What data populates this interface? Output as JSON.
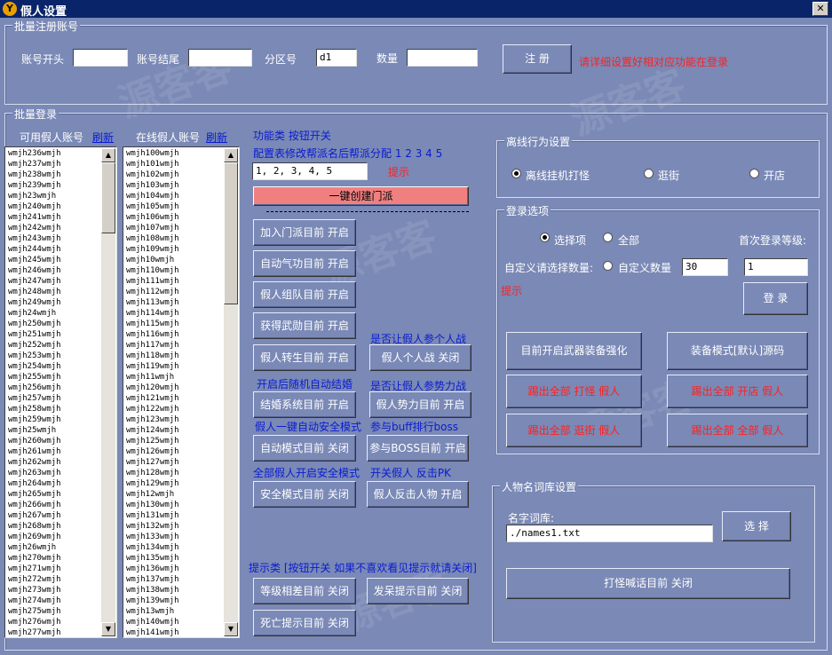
{
  "window": {
    "title": "假人设置",
    "app_icon": "Y"
  },
  "watermark": "源客客",
  "batch_register": {
    "title": "批量注册账号",
    "account_start_label": "账号开头",
    "account_start_value": "",
    "account_end_label": "账号结尾",
    "account_end_value": "",
    "zone_label": "分区号",
    "zone_value": "d1",
    "count_label": "数量",
    "count_value": "",
    "register_button": "注  册",
    "hint": "请详细设置好相对应功能在登录"
  },
  "batch_login": {
    "title": "批量登录",
    "available_label": "可用假人账号",
    "online_label": "在线假人账号",
    "refresh_label": "刷新",
    "available_list": [
      "wmjh236wmjh",
      "wmjh237wmjh",
      "wmjh238wmjh",
      "wmjh239wmjh",
      "wmjh23wmjh",
      "wmjh240wmjh",
      "wmjh241wmjh",
      "wmjh242wmjh",
      "wmjh243wmjh",
      "wmjh244wmjh",
      "wmjh245wmjh",
      "wmjh246wmjh",
      "wmjh247wmjh",
      "wmjh248wmjh",
      "wmjh249wmjh",
      "wmjh24wmjh",
      "wmjh250wmjh",
      "wmjh251wmjh",
      "wmjh252wmjh",
      "wmjh253wmjh",
      "wmjh254wmjh",
      "wmjh255wmjh",
      "wmjh256wmjh",
      "wmjh257wmjh",
      "wmjh258wmjh",
      "wmjh259wmjh",
      "wmjh25wmjh",
      "wmjh260wmjh",
      "wmjh261wmjh",
      "wmjh262wmjh",
      "wmjh263wmjh",
      "wmjh264wmjh",
      "wmjh265wmjh",
      "wmjh266wmjh",
      "wmjh267wmjh",
      "wmjh268wmjh",
      "wmjh269wmjh",
      "wmjh26wmjh",
      "wmjh270wmjh",
      "wmjh271wmjh",
      "wmjh272wmjh",
      "wmjh273wmjh",
      "wmjh274wmjh",
      "wmjh275wmjh",
      "wmjh276wmjh",
      "wmjh277wmjh"
    ],
    "online_list": [
      "wmjh100wmjh",
      "wmjh101wmjh",
      "wmjh102wmjh",
      "wmjh103wmjh",
      "wmjh104wmjh",
      "wmjh105wmjh",
      "wmjh106wmjh",
      "wmjh107wmjh",
      "wmjh108wmjh",
      "wmjh109wmjh",
      "wmjh10wmjh",
      "wmjh110wmjh",
      "wmjh111wmjh",
      "wmjh112wmjh",
      "wmjh113wmjh",
      "wmjh114wmjh",
      "wmjh115wmjh",
      "wmjh116wmjh",
      "wmjh117wmjh",
      "wmjh118wmjh",
      "wmjh119wmjh",
      "wmjh11wmjh",
      "wmjh120wmjh",
      "wmjh121wmjh",
      "wmjh122wmjh",
      "wmjh123wmjh",
      "wmjh124wmjh",
      "wmjh125wmjh",
      "wmjh126wmjh",
      "wmjh127wmjh",
      "wmjh128wmjh",
      "wmjh129wmjh",
      "wmjh12wmjh",
      "wmjh130wmjh",
      "wmjh131wmjh",
      "wmjh132wmjh",
      "wmjh133wmjh",
      "wmjh134wmjh",
      "wmjh135wmjh",
      "wmjh136wmjh",
      "wmjh137wmjh",
      "wmjh138wmjh",
      "wmjh139wmjh",
      "wmjh13wmjh",
      "wmjh140wmjh",
      "wmjh141wmjh"
    ]
  },
  "functions": {
    "header": "功能类 按钮开关",
    "config_label": "配置表修改帮派名后帮派分配 1 2 3 4 5",
    "config_value": "1, 2, 3, 4, 5",
    "tip": "提示",
    "create_sect_button": "一键创建门派",
    "join_sect": "加入门派目前 开启",
    "auto_qigong": "自动气功目前 开启",
    "fake_party": "假人组队目前 开启",
    "get_merit": "获得武勋目前 开启",
    "rebirth": "假人转生目前 开启",
    "pvp_caption": "是否让假人参个人战",
    "pvp_button": "假人个人战 关闭",
    "marriage_caption": "开启后随机自动结婚",
    "marriage_button": "结婚系统目前 开启",
    "faction_caption": "是否让假人参势力战",
    "faction_button": "假人势力目前 开启",
    "auto_safe_caption": "假人一键自动安全模式",
    "auto_mode_button": "自动模式目前 关闭",
    "boss_caption": "参与buff排行boss",
    "boss_button": "参与BOSS目前 开启",
    "all_safe_caption": "全部假人开启安全模式",
    "safe_mode_button": "安全模式目前 关闭",
    "counter_caption": "开关假人 反击PK",
    "counter_button": "假人反击人物 开启",
    "tips_header": "提示类 [按钮开关 如果不喜欢看见提示就请关闭]",
    "level_gap_button": "等级相差目前 关闭",
    "idle_tip_button": "发呆提示目前 关闭",
    "death_tip_button": "死亡提示目前 关闭"
  },
  "offline": {
    "title": "离线行为设置",
    "options": [
      "离线挂机打怪",
      "逛街",
      "开店"
    ],
    "selected": 0
  },
  "login_options": {
    "title": "登录选项",
    "option_select": "选择项",
    "option_all": "全部",
    "first_level_label": "首次登录等级:",
    "custom_label": "自定义请选择数量:",
    "custom_option": "自定义数量",
    "custom_value": "30",
    "first_level_value": "1",
    "tip": "提示",
    "login_button": "登  录",
    "weapon_button": "目前开启武器装备强化",
    "equip_button": "装备模式[默认]源码",
    "kick_fight": "踢出全部 打怪 假人",
    "kick_shop": "踢出全部 开店 假人",
    "kick_street": "踢出全部 逛街 假人",
    "kick_all": "踢出全部 全部 假人"
  },
  "name_lib": {
    "title": "人物名词库设置",
    "lib_label": "名字词库:",
    "lib_value": "./names1.txt",
    "select_button": "选 择",
    "shout_button": "打怪喊话目前 关闭"
  },
  "colors": {
    "bg": "#7A89B6",
    "title_bar": "#0A246A",
    "blue_text": "#0A1CD0",
    "red_text": "#FF2020",
    "pink_button": "#F08080"
  }
}
